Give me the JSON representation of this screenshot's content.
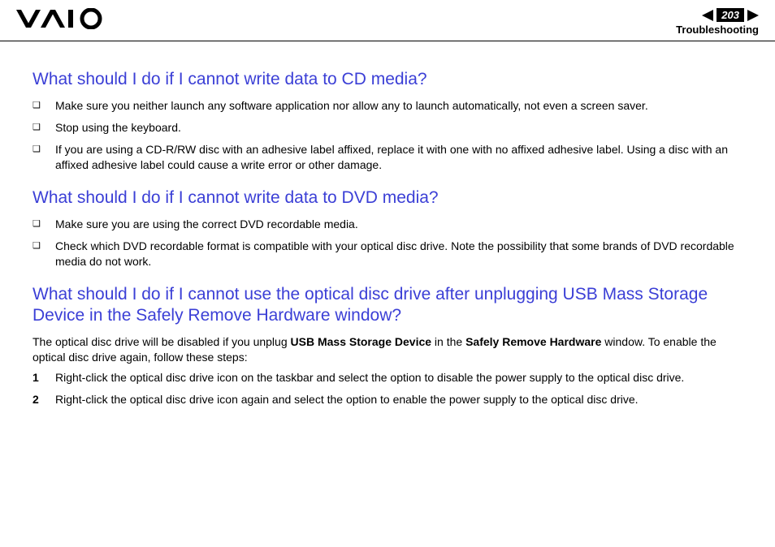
{
  "header": {
    "page_number": "203",
    "section": "Troubleshooting"
  },
  "sections": [
    {
      "heading": "What should I do if I cannot write data to CD media?",
      "bullets": [
        "Make sure you neither launch any software application nor allow any to launch automatically, not even a screen saver.",
        "Stop using the keyboard.",
        "If you are using a CD-R/RW disc with an adhesive label affixed, replace it with one with no affixed adhesive label. Using a disc with an affixed adhesive label could cause a write error or other damage."
      ]
    },
    {
      "heading": "What should I do if I cannot write data to DVD media?",
      "bullets": [
        "Make sure you are using the correct DVD recordable media.",
        "Check which DVD recordable format is compatible with your optical disc drive. Note the possibility that some brands of DVD recordable media do not work."
      ]
    },
    {
      "heading": "What should I do if I cannot use the optical disc drive after unplugging USB Mass Storage Device in the Safely Remove Hardware window?",
      "intro_pre": "The optical disc drive will be disabled if you unplug ",
      "intro_bold1": "USB Mass Storage Device",
      "intro_mid": " in the ",
      "intro_bold2": "Safely Remove Hardware",
      "intro_post": " window. To enable the optical disc drive again, follow these steps:",
      "steps": [
        "Right-click the optical disc drive icon on the taskbar and select the option to disable the power supply to the optical disc drive.",
        "Right-click the optical disc drive icon again and select the option to enable the power supply to the optical disc drive."
      ]
    }
  ],
  "marks": {
    "square": "❑",
    "n1": "1",
    "n2": "2"
  }
}
